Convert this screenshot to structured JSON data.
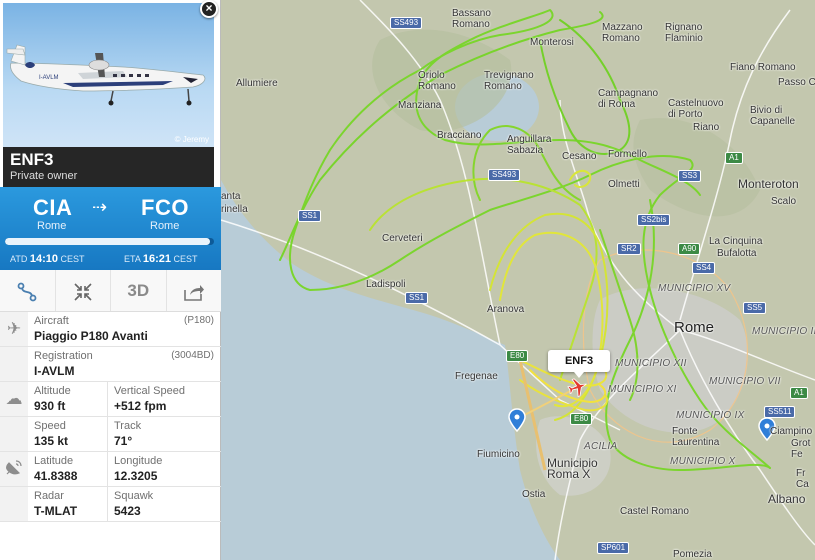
{
  "flight": {
    "callsign": "ENF3",
    "owner": "Private owner",
    "photo_credit": "© Jeremy",
    "photo_reg_text": "I-AVLM",
    "origin": {
      "code": "CIA",
      "city": "Rome"
    },
    "destination": {
      "code": "FCO",
      "city": "Rome"
    },
    "progress_fraction": 0.98,
    "atd_label": "ATD",
    "atd_time": "14:10",
    "atd_tz": "CEST",
    "eta_label": "ETA",
    "eta_time": "16:21",
    "eta_tz": "CEST"
  },
  "toolbar": {
    "route_icon": "route-icon",
    "expand_icon": "collapse-arrows-icon",
    "threed_label": "3D",
    "share_icon": "share-icon"
  },
  "details": {
    "aircraft": {
      "label": "Aircraft",
      "value": "Piaggio P180 Avanti",
      "code": "(P180)"
    },
    "registration": {
      "label": "Registration",
      "value": "I-AVLM",
      "code": "(3004BD)"
    },
    "altitude": {
      "label": "Altitude",
      "value": "930 ft"
    },
    "vertical_speed": {
      "label": "Vertical Speed",
      "value": "+512 fpm"
    },
    "speed": {
      "label": "Speed",
      "value": "135 kt"
    },
    "track": {
      "label": "Track",
      "value": "71°"
    },
    "latitude": {
      "label": "Latitude",
      "value": "41.8388"
    },
    "longitude": {
      "label": "Longitude",
      "value": "12.3205"
    },
    "radar": {
      "label": "Radar",
      "value": "T-MLAT"
    },
    "squawk": {
      "label": "Squawk",
      "value": "5423"
    }
  },
  "map": {
    "callout": "ENF3",
    "places": {
      "bassano": "Bassano\nRomano",
      "monterosi": "Monterosi",
      "mazzano": "Mazzano\nRomano",
      "rignano": "Rignano\nFlaminio",
      "allumiere": "Allumiere",
      "oriolo": "Oriolo\nRomano",
      "trevignano": "Trevignano\nRomano",
      "manziana": "Manziana",
      "campagnano": "Campagnano\ndi Roma",
      "fiano": "Fiano Romano",
      "passo": "Passo C",
      "castelnuovo": "Castelnuovo\ndi Porto",
      "bivio": "Bivio di\nCapanelle",
      "riano": "Riano",
      "bracciano": "Bracciano",
      "anguillara": "Anguillara\nSabazia",
      "cesano": "Cesano",
      "formello": "Formello",
      "olmetti": "Olmetti",
      "monterotondo": "Monteroton",
      "scalo": "Scalo",
      "santa": "anta",
      "marinella": "rinella",
      "cerveteri": "Cerveteri",
      "lacinquina": "La Cinquina",
      "bufalotta": "Bufalotta",
      "ladispoli": "Ladispoli",
      "municipio_xv": "MUNICIPIO XV",
      "aranova": "Aranova",
      "rome": "Rome",
      "municipio_iii": "MUNICIPIO III",
      "municipio_xii": "MUNICIPIO XII",
      "municipio_vii": "MUNICIPIO VII",
      "fregenae": "Fregenae",
      "municipio_xi": "MUNICIPIO XI",
      "municipio_ix": "MUNICIPIO IX",
      "fonte": "Fonte\nLaurentina",
      "ciampino": "Ciampino",
      "grott": "Grot\nFe",
      "acilia": "ACILIA",
      "municipio_x_u": "MUNICIPIO X",
      "fiumicino": "Fiumicino",
      "municipio_roma_x": "Municipio\nRoma X",
      "ostia": "Ostia",
      "castel_romano": "Castel Romano",
      "albano": "Albano",
      "pomezia": "Pomezia",
      "frattocchie": "Fr\nCa",
      "ta": "a"
    },
    "roads": {
      "ss493a": "SS493",
      "ss493b": "SS493",
      "ss3": "SS3",
      "a1a": "A1",
      "a1b": "A1",
      "ss1a": "SS1",
      "ss1b": "SS1",
      "ss2bis": "SS2bis",
      "sr2": "SR2",
      "a90": "A90",
      "ss4": "SS4",
      "ss5": "SS5",
      "e80a": "E80",
      "e80b": "E80",
      "ss511": "SS511",
      "sp601": "SP601"
    }
  }
}
